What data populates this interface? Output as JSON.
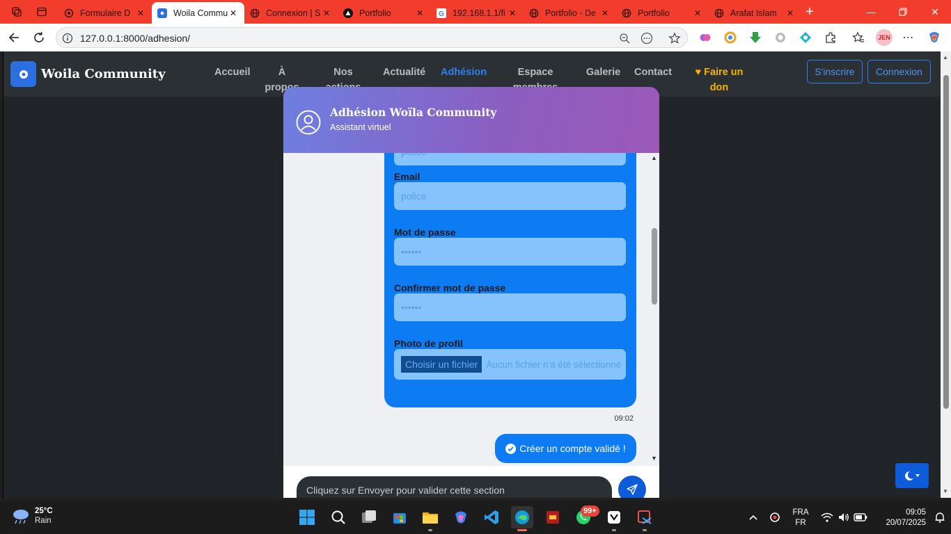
{
  "browser": {
    "tabs": [
      {
        "label": "Formulaire D"
      },
      {
        "label": "Woila Commu"
      },
      {
        "label": "Connexion | S"
      },
      {
        "label": "Portfolio"
      },
      {
        "label": "192.168.1.1/fi"
      },
      {
        "label": "Portfolio - De"
      },
      {
        "label": "Portfolio"
      },
      {
        "label": "Arafat Islam"
      }
    ],
    "url": "127.0.0.1:8000/adhesion/",
    "profile_initials": "JEN",
    "colors": {
      "tab_strip": "#f23c2c"
    }
  },
  "site": {
    "brand": "Woila Community",
    "nav": [
      {
        "label": "Accueil"
      },
      {
        "label": "À propos"
      },
      {
        "label": "Nos actions"
      },
      {
        "label": "Actualité"
      },
      {
        "label": "Adhésion"
      },
      {
        "label": "Espace membres"
      },
      {
        "label": "Galerie"
      },
      {
        "label": "Contact"
      },
      {
        "label": "Faire un don"
      }
    ],
    "signup_label": "S'inscrire",
    "login_label": "Connexion",
    "colors": {
      "navbar": "#2b3035",
      "accent": "#2f7ff0",
      "donate": "#f5b400"
    }
  },
  "chat": {
    "title": "Adhésion Woïla Community",
    "subtitle": "Assistant virtuel",
    "form": {
      "top_field_value": "police",
      "email_label": "Email",
      "email_value": "police",
      "password_label": "Mot de passe",
      "password_value": "••••••",
      "confirm_label": "Confirmer mot de passe",
      "confirm_value": "••••••",
      "photo_label": "Photo de profil",
      "file_button": "Choisir un fichier",
      "file_status": "Aucun fichier n'a été sélectionné"
    },
    "message_time": "09:02",
    "validated_message": "Créer un compte validé !",
    "input_placeholder": "Cliquez sur Envoyer pour valider cette section",
    "colors": {
      "header_start": "#6d7fe0",
      "header_end": "#9c59b8",
      "bubble": "#0d7cf2"
    }
  },
  "taskbar": {
    "weather_temp": "25°C",
    "weather_desc": "Rain",
    "notification_badge": "99+",
    "lang_top": "FRA",
    "lang_bottom": "FR",
    "time": "09:05",
    "date": "20/07/2025"
  }
}
